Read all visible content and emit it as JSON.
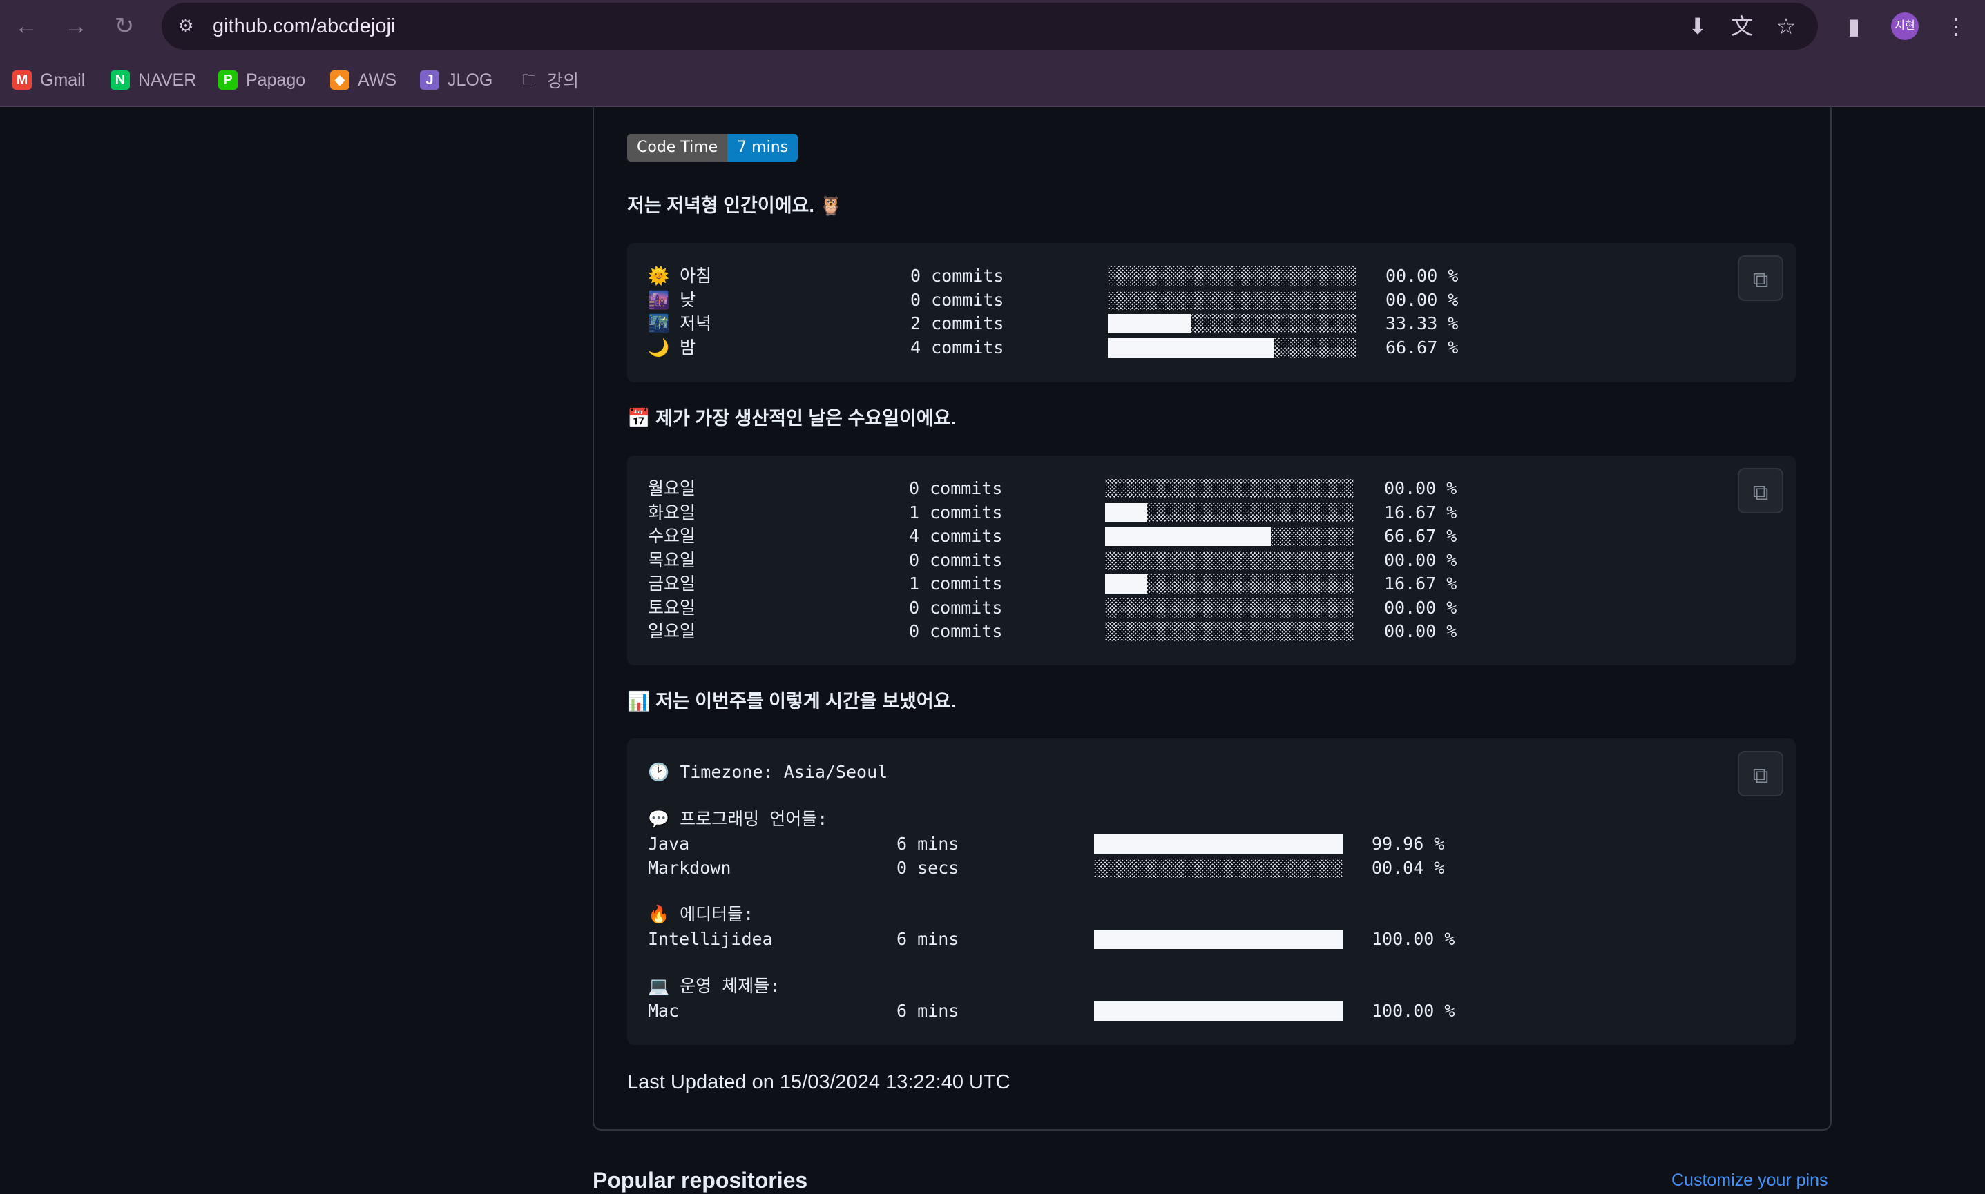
{
  "browser": {
    "url": "github.com/abcdejoji",
    "profile_initials": "지현",
    "bookmarks": [
      {
        "label": "Gmail",
        "icon": "gmail-icon"
      },
      {
        "label": "NAVER",
        "icon": "naver-icon"
      },
      {
        "label": "Papago",
        "icon": "papago-icon"
      },
      {
        "label": "AWS",
        "icon": "aws-icon"
      },
      {
        "label": "JLOG",
        "icon": "jlog-icon"
      },
      {
        "label": "강의",
        "icon": "folder-icon"
      }
    ]
  },
  "badge": {
    "label": "Code Time",
    "value": "7 mins"
  },
  "sections": {
    "time_of_day": {
      "heading": "저는 저녁형 인간이에요. 🦉",
      "rows": [
        {
          "label": "🌞 아침",
          "commits": "0 commits",
          "percent": "00.00 %",
          "fraction": 0
        },
        {
          "label": "🌆 낮",
          "commits": "0 commits",
          "percent": "00.00 %",
          "fraction": 0
        },
        {
          "label": "🌃 저녁",
          "commits": "2 commits",
          "percent": "33.33 %",
          "fraction": 0.3333
        },
        {
          "label": "🌙 밤",
          "commits": "4 commits",
          "percent": "66.67 %",
          "fraction": 0.6667
        }
      ]
    },
    "weekdays": {
      "heading": "📅 제가 가장 생산적인 날은 수요일이에요.",
      "rows": [
        {
          "label": "월요일",
          "commits": "0 commits",
          "percent": "00.00 %",
          "fraction": 0
        },
        {
          "label": "화요일",
          "commits": "1 commits",
          "percent": "16.67 %",
          "fraction": 0.1667
        },
        {
          "label": "수요일",
          "commits": "4 commits",
          "percent": "66.67 %",
          "fraction": 0.6667
        },
        {
          "label": "목요일",
          "commits": "0 commits",
          "percent": "00.00 %",
          "fraction": 0
        },
        {
          "label": "금요일",
          "commits": "1 commits",
          "percent": "16.67 %",
          "fraction": 0.1667
        },
        {
          "label": "토요일",
          "commits": "0 commits",
          "percent": "00.00 %",
          "fraction": 0
        },
        {
          "label": "일요일",
          "commits": "0 commits",
          "percent": "00.00 %",
          "fraction": 0
        }
      ]
    },
    "week": {
      "heading": "📊 저는 이번주를 이렇게 시간을 보냈어요.",
      "timezone": "🕑 Timezone: Asia/Seoul",
      "languages_title": "💬 프로그래밍 언어들:",
      "languages": [
        {
          "label": "Java",
          "time": "6 mins",
          "percent": "99.96 %",
          "fraction": 0.9996
        },
        {
          "label": "Markdown",
          "time": "0 secs",
          "percent": "00.04 %",
          "fraction": 0.0004
        }
      ],
      "editors_title": "🔥 에디터들:",
      "editors": [
        {
          "label": "Intellijidea",
          "time": "6 mins",
          "percent": "100.00 %",
          "fraction": 1
        }
      ],
      "os_title": "💻 운영 체제들:",
      "os": [
        {
          "label": "Mac",
          "time": "6 mins",
          "percent": "100.00 %",
          "fraction": 1
        }
      ]
    }
  },
  "last_updated": "Last Updated on 15/03/2024 13:22:40 UTC",
  "popular_repos": {
    "title": "Popular repositories",
    "customize": "Customize your pins"
  }
}
